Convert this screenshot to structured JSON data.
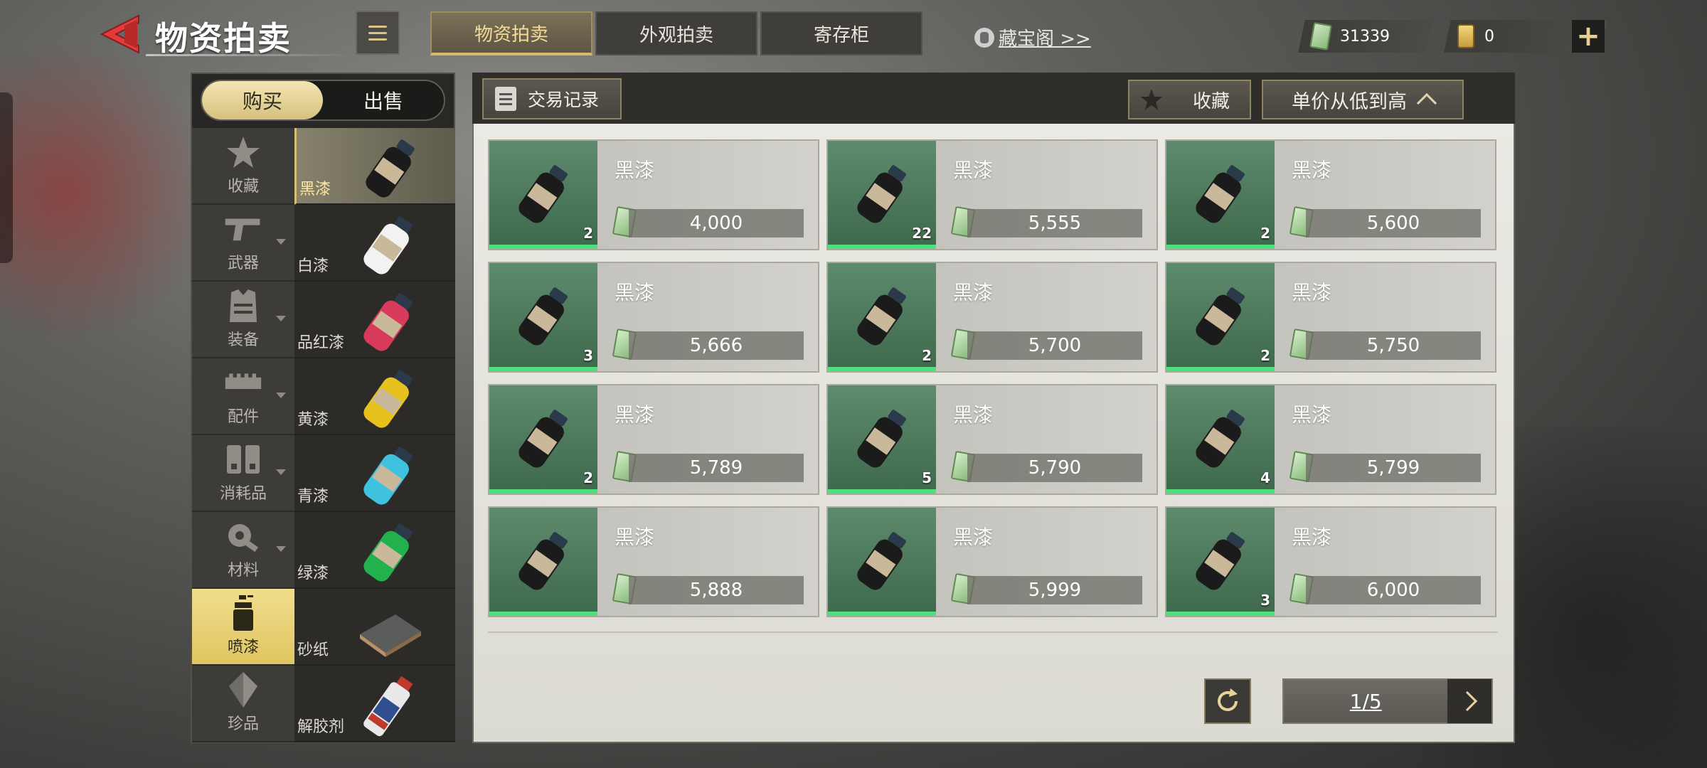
{
  "header": {
    "title": "物资拍卖",
    "tabs": [
      {
        "label": "物资拍卖",
        "active": true
      },
      {
        "label": "外观拍卖",
        "active": false
      },
      {
        "label": "寄存柜",
        "active": false
      }
    ],
    "treasure_link": "藏宝阁 >>",
    "currency_cash": "31339",
    "currency_ticket": "0",
    "plus_label": "+"
  },
  "sidebar": {
    "mode": {
      "buy": "购买",
      "sell": "出售",
      "active": "buy"
    },
    "categories": [
      {
        "label": "收藏",
        "icon": "star-icon",
        "active": false
      },
      {
        "label": "武器",
        "icon": "pistol-icon",
        "active": false
      },
      {
        "label": "装备",
        "icon": "vest-icon",
        "active": false
      },
      {
        "label": "配件",
        "icon": "rail-icon",
        "active": false
      },
      {
        "label": "消耗品",
        "icon": "medkit-icon",
        "active": false
      },
      {
        "label": "材料",
        "icon": "wrench-gear-icon",
        "active": false
      },
      {
        "label": "喷漆",
        "icon": "spray-can-icon",
        "active": true
      },
      {
        "label": "珍品",
        "icon": "diamond-icon",
        "active": false
      }
    ],
    "subitems": [
      {
        "label": "黑漆",
        "color": "#1b1b1b",
        "active": true
      },
      {
        "label": "白漆",
        "color": "#f2f2f2",
        "active": false
      },
      {
        "label": "品红漆",
        "color": "#d83a5c",
        "active": false
      },
      {
        "label": "黄漆",
        "color": "#e7c21e",
        "active": false
      },
      {
        "label": "青漆",
        "color": "#3fc2e0",
        "active": false
      },
      {
        "label": "绿漆",
        "color": "#22b14c",
        "active": false
      },
      {
        "label": "砂纸",
        "color": "#6f6f6f",
        "active": false
      },
      {
        "label": "解胶剂",
        "color": "#c0392b",
        "active": false
      }
    ]
  },
  "toolbar": {
    "records_label": "交易记录",
    "favorite_label": "收藏",
    "sort_label": "单价从低到高"
  },
  "listings": [
    {
      "name": "黑漆",
      "qty": "2",
      "price": "4,000"
    },
    {
      "name": "黑漆",
      "qty": "22",
      "price": "5,555"
    },
    {
      "name": "黑漆",
      "qty": "2",
      "price": "5,600"
    },
    {
      "name": "黑漆",
      "qty": "3",
      "price": "5,666"
    },
    {
      "name": "黑漆",
      "qty": "2",
      "price": "5,700"
    },
    {
      "name": "黑漆",
      "qty": "2",
      "price": "5,750"
    },
    {
      "name": "黑漆",
      "qty": "2",
      "price": "5,789"
    },
    {
      "name": "黑漆",
      "qty": "5",
      "price": "5,790"
    },
    {
      "name": "黑漆",
      "qty": "4",
      "price": "5,799"
    },
    {
      "name": "黑漆",
      "qty": "",
      "price": "5,888"
    },
    {
      "name": "黑漆",
      "qty": "",
      "price": "5,999"
    },
    {
      "name": "黑漆",
      "qty": "3",
      "price": "6,000"
    }
  ],
  "pagination": {
    "page": "1/5"
  },
  "colors": {
    "accent_gold": "#d8b964",
    "stock_green": "#4ee07c"
  }
}
